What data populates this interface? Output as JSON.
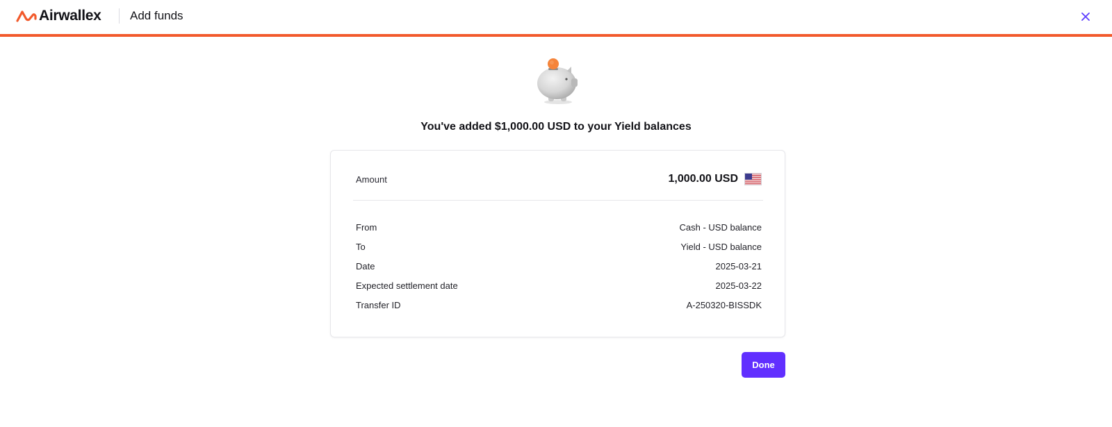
{
  "header": {
    "brand": "Airwallex",
    "title": "Add funds",
    "close_icon": "close-icon",
    "accent_color": "#f25a2c"
  },
  "confirmation": {
    "illustration": "piggy-bank-icon",
    "headline": "You've added $1,000.00 USD to your Yield balances"
  },
  "summary": {
    "amount_label": "Amount",
    "amount_value": "1,000.00 USD",
    "currency_flag": "us-flag-icon",
    "details": [
      {
        "label": "From",
        "value": "Cash - USD balance"
      },
      {
        "label": "To",
        "value": "Yield - USD balance"
      },
      {
        "label": "Date",
        "value": "2025-03-21"
      },
      {
        "label": "Expected settlement date",
        "value": "2025-03-22"
      },
      {
        "label": "Transfer ID",
        "value": "A-250320-BISSDK"
      }
    ]
  },
  "actions": {
    "done_label": "Done",
    "button_color": "#612fff"
  }
}
